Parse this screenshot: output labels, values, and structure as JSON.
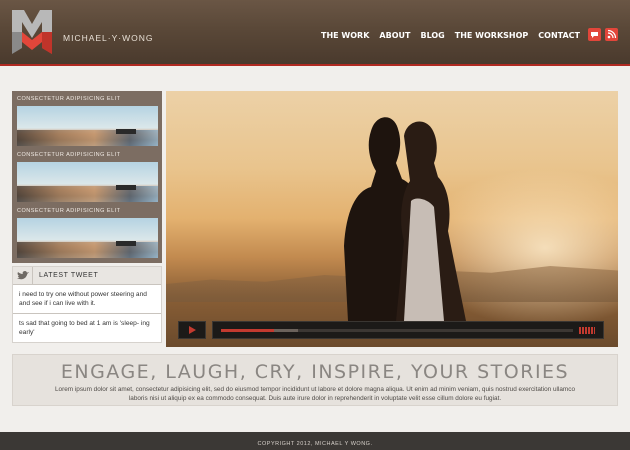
{
  "header": {
    "site_name": "MICHAEL·Y·WONG",
    "nav": [
      "THE WORK",
      "ABOUT",
      "BLOG",
      "THE WORKSHOP",
      "CONTACT"
    ],
    "social_icons": [
      "chat-icon",
      "rss-icon"
    ],
    "brand_color": "#b02a22"
  },
  "sidebar": {
    "thumbnails": [
      {
        "label": "CONSECTETUR ADIPISICING ELIT"
      },
      {
        "label": "CONSECTETUR ADIPISICING ELIT"
      },
      {
        "label": "CONSECTETUR ADIPISICING ELIT"
      }
    ],
    "tweets": {
      "title": "LATEST TWEET",
      "items": [
        "i need to try one without power steering and and see if i can live with it.",
        "ts sad that going to bed at 1 am is 'sleep- ing early'"
      ]
    }
  },
  "video": {
    "progress": 0.15,
    "buffered": 0.22
  },
  "tagline": {
    "title": "ENGAGE, LAUGH, CRY, INSPIRE, YOUR STORIES",
    "body": "Lorem ipsum dolor sit amet, consectetur adipisicing elit, sed do eiusmod tempor incididunt ut labore et dolore magna aliqua. Ut enim ad minim veniam, quis nostrud exercitation ullamco laboris nisi ut aliquip ex ea commodo consequat. Duis aute irure dolor in reprehenderit in voluptate velit esse cillum dolore eu fugiat."
  },
  "footer": {
    "copyright": "COPYRIGHT 2012, MICHAEL Y WONG."
  }
}
